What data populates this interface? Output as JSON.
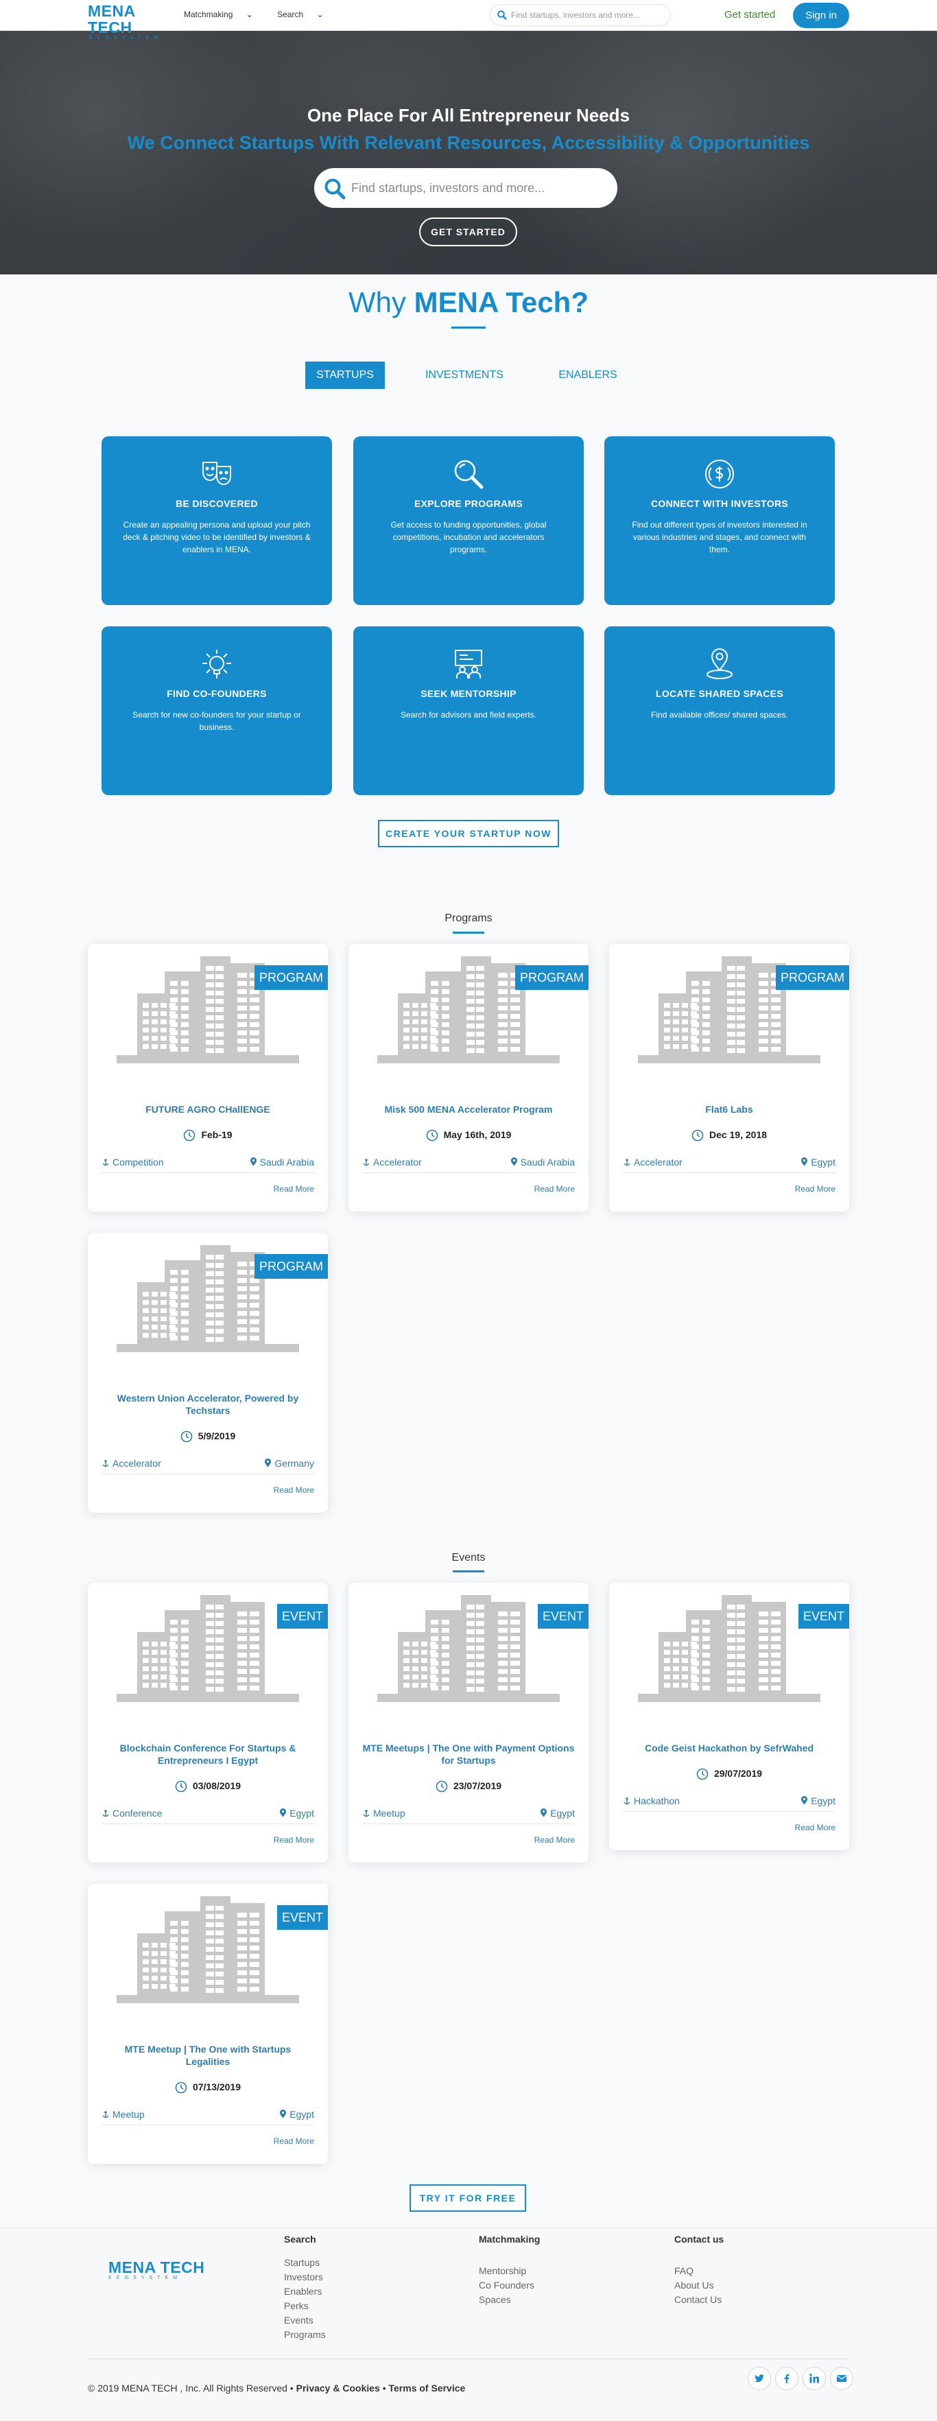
{
  "nav": {
    "logo_main": "MENA TECH",
    "logo_sub": "ECOSYSTEM",
    "matchmaking": "Matchmaking",
    "search": "Search",
    "search_placeholder": "Find startups, investors and more...",
    "get_started": "Get started",
    "sign_in": "Sign in"
  },
  "hero": {
    "title": "One Place For All Entrepreneur Needs",
    "subtitle": "We Connect Startups With Relevant Resources, Accessibility & Opportunities",
    "search_placeholder": "Find startups, investors and more...",
    "cta": "GET STARTED"
  },
  "why": {
    "prefix": "Why ",
    "brand": "MENA Tech?",
    "tabs": [
      "STARTUPS",
      "INVESTMENTS",
      "ENABLERS"
    ],
    "active_tab": "STARTUPS",
    "cta": "CREATE YOUR STARTUP NOW"
  },
  "features": [
    {
      "icon": "theater-masks-icon",
      "title": "BE DISCOVERED",
      "text": "Create an appealing persona and upload your pitch deck & pitching video to be identified by investors & enablers in MENA."
    },
    {
      "icon": "magnifier-icon",
      "title": "EXPLORE PROGRAMS",
      "text": "Get access to funding opportunities, global competitions, incubation and accelerators programs."
    },
    {
      "icon": "dollar-coin-icon",
      "title": "CONNECT WITH INVESTORS",
      "text": "Find out different types of investors interested in various industries and stages, and connect with them."
    },
    {
      "icon": "idea-bulb-icon",
      "title": "FIND CO-FOUNDERS",
      "text": "Search for new co-founders for your startup or business."
    },
    {
      "icon": "mentor-board-icon",
      "title": "SEEK MENTORSHIP",
      "text": "Search for advisors and field experts."
    },
    {
      "icon": "location-pin-icon",
      "title": "LOCATE SHARED SPACES",
      "text": "Find available offices/ shared spaces."
    }
  ],
  "programs": {
    "heading": "Programs",
    "badge": "PROGRAM",
    "read_more": "Read More",
    "items": [
      {
        "name": "FUTURE AGRO CHallENGE",
        "date": "Feb-19",
        "category": "Competition",
        "location": "Saudi Arabia"
      },
      {
        "name": "Misk 500 MENA Accelerator Program",
        "date": "May 16th, 2019",
        "category": "Accelerator",
        "location": "Saudi Arabia"
      },
      {
        "name": "Flat6 Labs",
        "date": "Dec 19, 2018",
        "category": "Accelerator",
        "location": "Egypt"
      },
      {
        "name": "Western Union Accelerator, Powered by Techstars",
        "date": "5/9/2019",
        "category": "Accelerator",
        "location": "Germany"
      }
    ]
  },
  "events": {
    "heading": "Events",
    "badge": "EVENT",
    "read_more": "Read More",
    "cta": "TRY IT FOR FREE",
    "items": [
      {
        "name": "Blockchain Conference For Startups & Entrepreneurs I Egypt",
        "date": "03/08/2019",
        "category": "Conference",
        "location": "Egypt"
      },
      {
        "name": "MTE Meetups | The One with Payment Options for Startups",
        "date": "23/07/2019",
        "category": "Meetup",
        "location": "Egypt"
      },
      {
        "name": "Code Geist Hackathon by SefrWahed",
        "date": "29/07/2019",
        "category": "Hackathon",
        "location": "Egypt"
      },
      {
        "name": "MTE Meetup | The One with Startups Legalities",
        "date": "07/13/2019",
        "category": "Meetup",
        "location": "Egypt"
      }
    ]
  },
  "footer": {
    "logo_main": "MENA TECH",
    "logo_sub": "ECOSYSTEM",
    "search_heading": "Search",
    "search_links": [
      "Startups",
      "Investors",
      "Enablers",
      "Perks",
      "Events",
      "Programs"
    ],
    "matchmaking_heading": "Matchmaking",
    "matchmaking_links": [
      "Mentorship",
      "Co Founders",
      "Spaces"
    ],
    "contact_heading": "Contact us",
    "contact_links": [
      "FAQ",
      "About Us",
      "Contact Us"
    ],
    "copyright": "© 2019 MENA TECH , Inc. All Rights Reserved •",
    "privacy": "Privacy & Cookies",
    "bullet": " • ",
    "terms": "Terms of Service",
    "social": [
      "twitter-icon",
      "facebook-icon",
      "linkedin-icon",
      "email-icon"
    ]
  },
  "colors": {
    "brand": "#168ccd",
    "link": "#2d7db0",
    "get_started": "#3a8f2a"
  }
}
